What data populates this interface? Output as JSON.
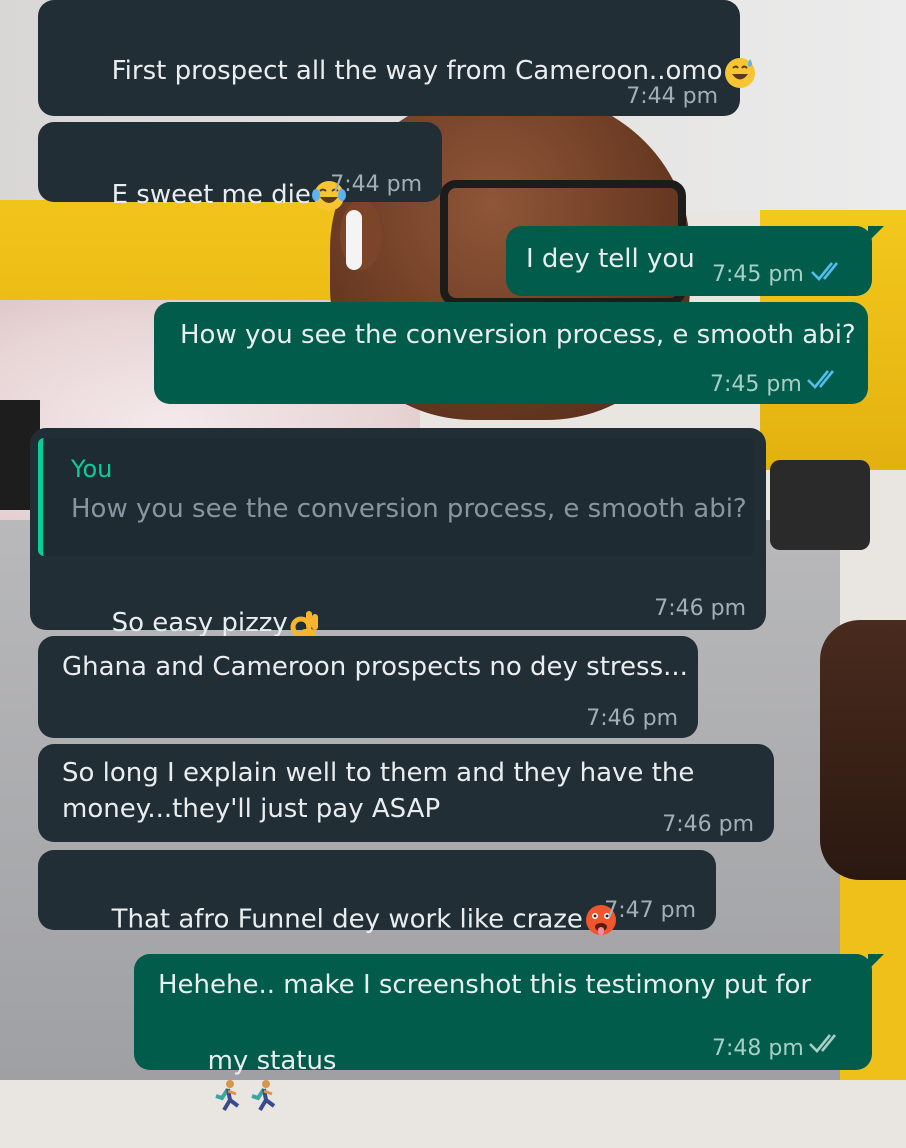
{
  "messages": [
    {
      "text": "First prospect all the way from Cameroon..omo",
      "emoji": "sweat-smile-emoji",
      "time": "7:44 pm",
      "direction": "incoming"
    },
    {
      "text": "E sweet me die",
      "emoji": "tears-of-joy-emoji",
      "time": "7:44 pm",
      "direction": "incoming"
    },
    {
      "text": "I dey tell you",
      "time": "7:45 pm",
      "direction": "outgoing",
      "status": "read"
    },
    {
      "text": "How you see the conversion process, e smooth abi?",
      "time": "7:45 pm",
      "direction": "outgoing",
      "status": "read"
    },
    {
      "quote_author": "You",
      "quote_text": "How you see the conversion process, e smooth abi?",
      "text": "So easy pizzy",
      "emoji": "ok-hand-emoji",
      "time": "7:46 pm",
      "direction": "incoming"
    },
    {
      "text": "Ghana and Cameroon prospects no dey stress...",
      "time": "7:46 pm",
      "direction": "incoming"
    },
    {
      "text_line1": "So long I explain well to them and they have the",
      "text_line2": "money...they'll just pay ASAP",
      "time": "7:46 pm",
      "direction": "incoming"
    },
    {
      "text": "That afro Funnel dey work like craze",
      "emoji": "hot-face-emoji",
      "time": "7:47 pm",
      "direction": "incoming"
    },
    {
      "text_line1": "Hehehe.. make I screenshot this testimony put for",
      "text_line2": "my status",
      "emoji": "person-running-emoji",
      "time": "7:48 pm",
      "direction": "outgoing",
      "status": "delivered"
    }
  ],
  "colors": {
    "incoming_bubble": "#222e35",
    "outgoing_bubble": "#015c4b",
    "read_tick": "#53bdeb",
    "delivered_tick": "#a8cec5",
    "quote_accent": "#06cf9c"
  }
}
